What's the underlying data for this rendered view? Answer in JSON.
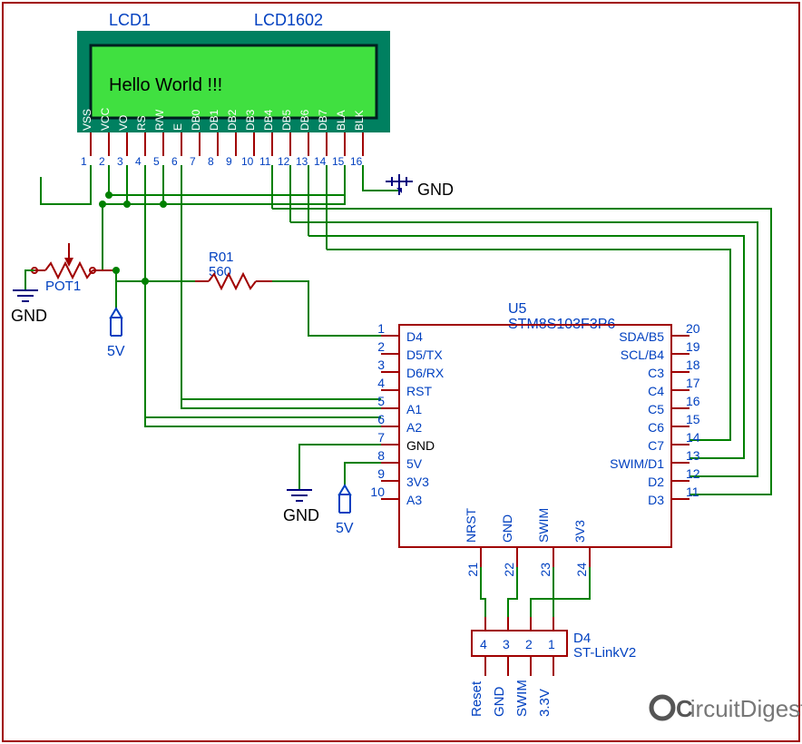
{
  "lcd": {
    "ref": "LCD1",
    "part": "LCD1602",
    "display_text": "Hello World !!!",
    "pins": [
      "VSS",
      "VCC",
      "VO",
      "RS",
      "R/W",
      "E",
      "DB0",
      "DB1",
      "DB2",
      "DB3",
      "DB4",
      "DB5",
      "DB6",
      "DB7",
      "BLA",
      "BLK"
    ],
    "pin_numbers": [
      "1",
      "2",
      "3",
      "4",
      "5",
      "6",
      "7",
      "8",
      "9",
      "10",
      "11",
      "12",
      "13",
      "14",
      "15",
      "16"
    ]
  },
  "pot": {
    "ref": "POT1"
  },
  "resistor": {
    "ref": "R01",
    "value": "560"
  },
  "mcu": {
    "ref": "U5",
    "part": "STM8S103F3P6",
    "left_pins": [
      {
        "n": "1",
        "name": "D4"
      },
      {
        "n": "2",
        "name": "D5/TX"
      },
      {
        "n": "3",
        "name": "D6/RX"
      },
      {
        "n": "4",
        "name": "RST"
      },
      {
        "n": "5",
        "name": "A1"
      },
      {
        "n": "6",
        "name": "A2"
      },
      {
        "n": "7",
        "name": "GND"
      },
      {
        "n": "8",
        "name": "5V"
      },
      {
        "n": "9",
        "name": "3V3"
      },
      {
        "n": "10",
        "name": "A3"
      }
    ],
    "right_pins": [
      {
        "n": "20",
        "name": "SDA/B5"
      },
      {
        "n": "19",
        "name": "SCL/B4"
      },
      {
        "n": "18",
        "name": "C3"
      },
      {
        "n": "17",
        "name": "C4"
      },
      {
        "n": "16",
        "name": "C5"
      },
      {
        "n": "15",
        "name": "C6"
      },
      {
        "n": "14",
        "name": "C7"
      },
      {
        "n": "13",
        "name": "SWIM/D1"
      },
      {
        "n": "12",
        "name": "D2"
      },
      {
        "n": "11",
        "name": "D3"
      }
    ],
    "bottom_pins": [
      {
        "n": "21",
        "name": "NRST"
      },
      {
        "n": "22",
        "name": "GND"
      },
      {
        "n": "23",
        "name": "SWIM"
      },
      {
        "n": "24",
        "name": "3V3"
      }
    ]
  },
  "stlink": {
    "ref": "D4",
    "part": "ST-LinkV2",
    "pins": [
      {
        "n": "4",
        "name": "Reset"
      },
      {
        "n": "3",
        "name": "GND"
      },
      {
        "n": "2",
        "name": "SWIM"
      },
      {
        "n": "1",
        "name": "3.3V"
      }
    ]
  },
  "gnd_labels": {
    "g1": "GND",
    "g2": "GND",
    "g3": "GND",
    "g4": "GND"
  },
  "pwr_labels": {
    "p1": "5V",
    "p2": "5V"
  },
  "logo": {
    "prefix": "C",
    "suffix": "ircuitDigest"
  }
}
